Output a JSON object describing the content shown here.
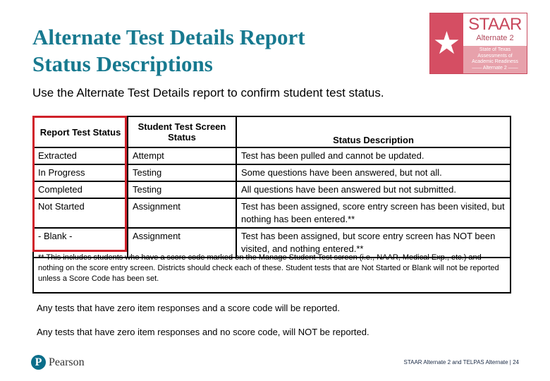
{
  "header": {
    "title_line1": "Alternate Test Details Report",
    "title_line2": "Status Descriptions",
    "subtitle": "Use the Alternate Test Details report to confirm student test status."
  },
  "logo": {
    "brand": "STAAR",
    "edition": "Alternate 2",
    "tagline_lines": [
      "State of Texas",
      "Assessments of",
      "Academic Readiness",
      "—— Alternate 2 ——"
    ],
    "icon": "star-icon",
    "colors": {
      "primary": "#d54e63",
      "light": "#e7a1ab"
    }
  },
  "table": {
    "headers": [
      "Report Test Status",
      "Student Test Screen Status",
      "Status Description"
    ],
    "rows": [
      [
        "Extracted",
        "Attempt",
        "Test has been pulled and cannot be updated."
      ],
      [
        "In Progress",
        "Testing",
        "Some questions have been answered, but not all."
      ],
      [
        "Completed",
        "Testing",
        "All questions have been answered but not submitted."
      ],
      [
        "Not Started",
        "Assignment",
        "Test has been assigned, score entry screen has been visited, but nothing has been entered.**"
      ],
      [
        "- Blank -",
        "Assignment",
        "Test has been assigned, but score entry screen has NOT been visited, and nothing entered.**"
      ]
    ],
    "footnote": "** This includes students who have a score code marked on the Manage Student Test screen (i.e., NAAR, Medical Exp., etc.) and nothing on the score entry screen. Districts should check each of these.  Student tests that are Not Started or Blank will not be reported unless a Score Code has been set.",
    "highlight_color": "#d0212a"
  },
  "notes": [
    "Any tests that have zero item responses and a score code will be reported.",
    "Any tests that have zero item responses and no score code, will NOT be reported."
  ],
  "footer": {
    "company": "Pearson",
    "company_icon": "pearson-p-icon",
    "page_label": "STAAR Alternate 2 and TELPAS Alternate | 24"
  },
  "colors": {
    "title": "#17798f"
  }
}
